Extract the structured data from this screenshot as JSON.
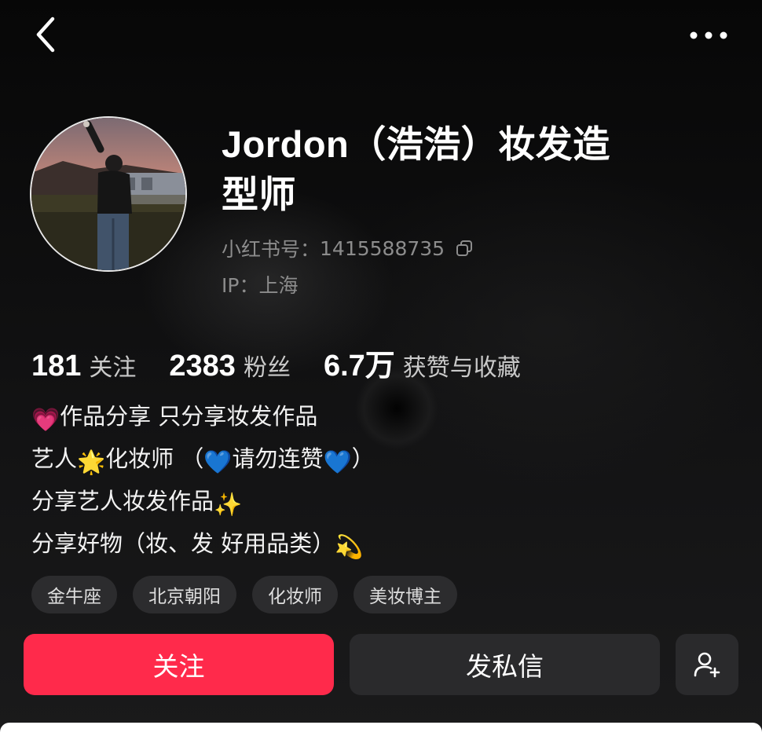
{
  "header": {
    "back_icon": "chevron-left-icon",
    "more_icon": "more-horizontal-icon"
  },
  "profile": {
    "name": "Jordon（浩浩）妆发造型师",
    "rednote_id_label": "小红书号：",
    "rednote_id": "1415588735",
    "ip_label": "IP：",
    "ip_location": "上海",
    "avatar": "avatar-photo"
  },
  "stats": [
    {
      "value": "181",
      "label": "关注"
    },
    {
      "value": "2383",
      "label": "粉丝"
    },
    {
      "value": "6.7万",
      "label": "获赞与收藏"
    }
  ],
  "bio": [
    {
      "emoji_before": "💗",
      "text": "作品分享 只分享妆发作品",
      "emoji_after": ""
    },
    {
      "segments": [
        "艺人",
        "🌟",
        "化妆师 （",
        "💙",
        "请勿连赞",
        "💙",
        "）"
      ]
    },
    {
      "emoji_before": "",
      "text": "分享艺人妆发作品",
      "emoji_after": "✨"
    },
    {
      "emoji_before": "",
      "text": "分享好物（妆、发 好用品类）",
      "emoji_after": "💫"
    }
  ],
  "tags": [
    "金牛座",
    "北京朝阳",
    "化妆师",
    "美妆博主"
  ],
  "actions": {
    "follow_label": "关注",
    "message_label": "发私信",
    "add_friend_icon": "add-user-icon"
  },
  "colors": {
    "accent": "#ff2a4b",
    "background": "#0c0c0d",
    "secondary_button": "#2a2a2c",
    "tag_background": "#2c2c2e",
    "muted_text": "#8c8c8c"
  }
}
